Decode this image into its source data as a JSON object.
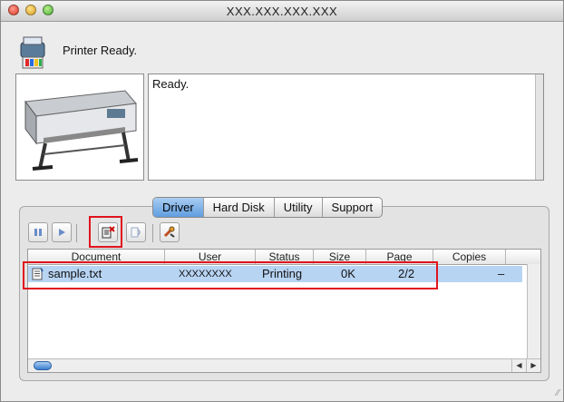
{
  "window": {
    "title": "XXX.XXX.XXX.XXX"
  },
  "status": {
    "text": "Printer Ready."
  },
  "message": {
    "text": "Ready."
  },
  "tabs": [
    {
      "label": "Driver",
      "active": true
    },
    {
      "label": "Hard Disk",
      "active": false
    },
    {
      "label": "Utility",
      "active": false
    },
    {
      "label": "Support",
      "active": false
    }
  ],
  "toolbar": {
    "buttons": [
      "pause-icon",
      "play-icon",
      "delete-job-icon",
      "resume-icon",
      "tools-icon"
    ]
  },
  "table": {
    "columns": [
      "Document",
      "User",
      "Status",
      "Size",
      "Page",
      "Copies"
    ],
    "rows": [
      {
        "document": "sample.txt",
        "user": "XXXXXXXX",
        "status": "Printing",
        "size": "0K",
        "page": "2/2",
        "copies": "–"
      }
    ]
  },
  "colors": {
    "selection": "#b8d4f3",
    "highlight": "#e0141e",
    "accent": "#5f9de0"
  }
}
